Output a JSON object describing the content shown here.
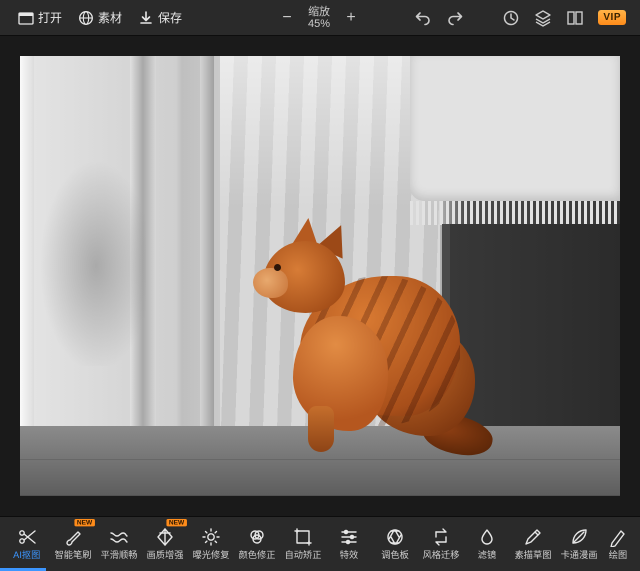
{
  "topbar": {
    "open": "打开",
    "assets": "素材",
    "save": "保存",
    "zoom_label": "缩放",
    "zoom_value": "45%",
    "vip": "VIP"
  },
  "canvas": {
    "subject": "orange-cat",
    "effect": "color-splash-monochrome-background"
  },
  "tools": [
    {
      "id": "ai-cutout",
      "label": "AI抠图",
      "icon": "scissors",
      "new": false,
      "active": true
    },
    {
      "id": "smart-brush",
      "label": "智能笔刷",
      "icon": "brush",
      "new": true,
      "active": false
    },
    {
      "id": "smooth",
      "label": "平滑顺畅",
      "icon": "waves",
      "new": false,
      "active": false
    },
    {
      "id": "enhance",
      "label": "画质增强",
      "icon": "diamond",
      "new": true,
      "active": false
    },
    {
      "id": "exposure",
      "label": "曝光修复",
      "icon": "sun",
      "new": false,
      "active": false
    },
    {
      "id": "color-correct",
      "label": "颜色修正",
      "icon": "rgb",
      "new": false,
      "active": false
    },
    {
      "id": "straighten",
      "label": "自动矫正",
      "icon": "crop",
      "new": false,
      "active": false
    },
    {
      "id": "effects",
      "label": "特效",
      "icon": "sliders",
      "new": false,
      "active": false
    },
    {
      "id": "palette",
      "label": "调色板",
      "icon": "aperture",
      "new": false,
      "active": false
    },
    {
      "id": "style-transfer",
      "label": "风格迁移",
      "icon": "swap",
      "new": false,
      "active": false
    },
    {
      "id": "filters",
      "label": "滤镜",
      "icon": "droplet",
      "new": false,
      "active": false
    },
    {
      "id": "sketch",
      "label": "素描草图",
      "icon": "pencil",
      "new": false,
      "active": false
    },
    {
      "id": "cartoon",
      "label": "卡通漫画",
      "icon": "leaf",
      "new": false,
      "active": false
    },
    {
      "id": "draw",
      "label": "绘图",
      "icon": "pen",
      "new": false,
      "active": false
    }
  ],
  "new_tag_text": "NEW"
}
